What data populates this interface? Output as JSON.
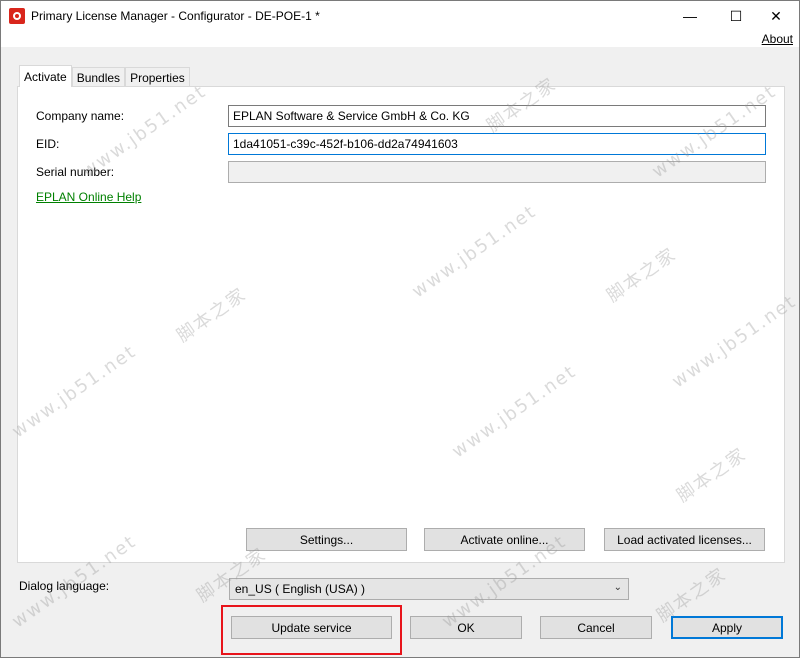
{
  "window": {
    "title": "Primary License Manager - Configurator - DE-POE-1 *",
    "controls": {
      "minimize": "—",
      "maximize": "☐",
      "close": "✕"
    }
  },
  "menu": {
    "about": "About"
  },
  "tabs": [
    {
      "label": "Activate",
      "active": true
    },
    {
      "label": "Bundles",
      "active": false
    },
    {
      "label": "Properties",
      "active": false
    }
  ],
  "form": {
    "company_name": {
      "label": "Company name:",
      "value": "EPLAN Software & Service GmbH & Co. KG"
    },
    "eid": {
      "label": "EID:",
      "value": "1da41051-c39c-452f-b106-dd2a74941603"
    },
    "serial_number": {
      "label": "Serial number:",
      "value": ""
    },
    "help_link": "EPLAN Online Help"
  },
  "panel_buttons": {
    "settings": "Settings...",
    "activate_online": "Activate online...",
    "load_activated": "Load activated licenses..."
  },
  "dialog_language": {
    "label": "Dialog language:",
    "value": "en_US ( English (USA) )"
  },
  "footer_buttons": {
    "update_service": "Update service",
    "ok": "OK",
    "cancel": "Cancel",
    "apply": "Apply"
  },
  "watermark": {
    "site": "www.jb51.net",
    "brand": "脚本之家"
  },
  "colors": {
    "highlight": "#e8141b",
    "link": "#008000",
    "focus": "#0078d7"
  },
  "icons": {
    "app": "eplan-app-icon",
    "dropdown": "chevron-down-icon"
  }
}
